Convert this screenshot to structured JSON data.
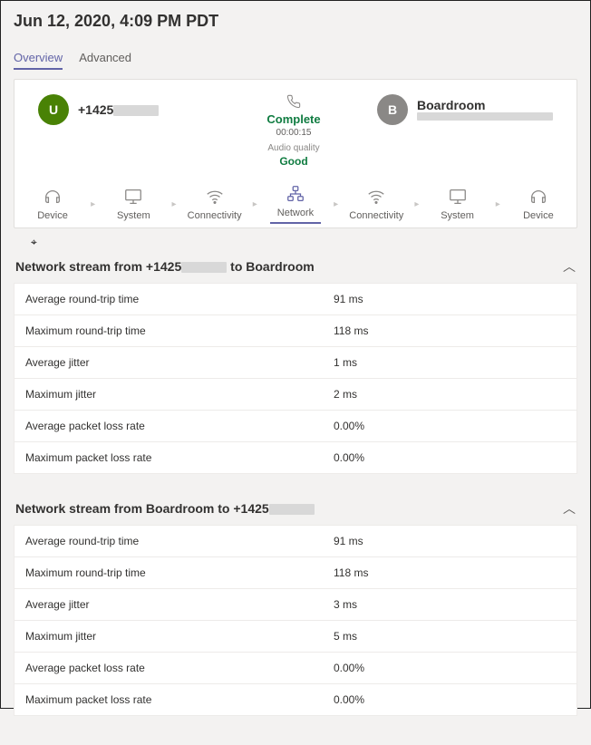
{
  "page_title": "Jun 12, 2020, 4:09 PM PDT",
  "tabs": {
    "overview": "Overview",
    "advanced": "Advanced",
    "active": "overview"
  },
  "call": {
    "caller": {
      "initial": "U",
      "name_prefix": "+1425"
    },
    "status": "Complete",
    "duration": "00:00:15",
    "audio_quality_label": "Audio quality",
    "audio_quality": "Good",
    "callee": {
      "initial": "B",
      "name": "Boardroom"
    }
  },
  "flow": {
    "items": [
      "Device",
      "System",
      "Connectivity",
      "Network",
      "Connectivity",
      "System",
      "Device"
    ],
    "selected_index": 3
  },
  "stream1": {
    "title_prefix": "Network stream from +1425",
    "title_suffix": " to Boardroom",
    "rows": [
      {
        "k": "Average round-trip time",
        "v": "91 ms"
      },
      {
        "k": "Maximum round-trip time",
        "v": "118 ms"
      },
      {
        "k": "Average jitter",
        "v": "1 ms"
      },
      {
        "k": "Maximum jitter",
        "v": "2 ms"
      },
      {
        "k": "Average packet loss rate",
        "v": "0.00%"
      },
      {
        "k": "Maximum packet loss rate",
        "v": "0.00%"
      }
    ]
  },
  "stream2": {
    "title_prefix": "Network stream from Boardroom to +1425",
    "rows": [
      {
        "k": "Average round-trip time",
        "v": "91 ms"
      },
      {
        "k": "Maximum round-trip time",
        "v": "118 ms"
      },
      {
        "k": "Average jitter",
        "v": "3 ms"
      },
      {
        "k": "Maximum jitter",
        "v": "5 ms"
      },
      {
        "k": "Average packet loss rate",
        "v": "0.00%"
      },
      {
        "k": "Maximum packet loss rate",
        "v": "0.00%"
      }
    ]
  }
}
